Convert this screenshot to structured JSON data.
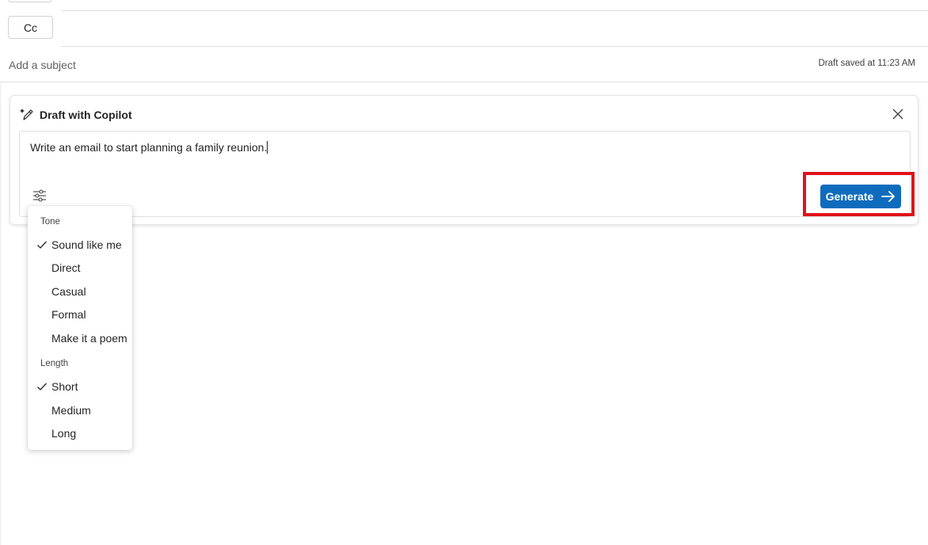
{
  "header": {
    "cc_label": "Cc",
    "subject_placeholder": "Add a subject",
    "draft_status": "Draft saved at 11:23 AM"
  },
  "copilot": {
    "title": "Draft with Copilot",
    "prompt_text": "Write an email to start planning a family reunion.",
    "generate_label": "Generate",
    "accent_color": "#0f6cbd",
    "highlight_color": "#e0131b",
    "icons": {
      "title_icon": "copilot-pen-sparkle-icon",
      "close_icon": "close-icon",
      "options_icon": "sliders-icon",
      "generate_icon": "arrow-right-icon"
    }
  },
  "menu": {
    "tone_header": "Tone",
    "tone_items": [
      {
        "label": "Sound like me",
        "selected": true
      },
      {
        "label": "Direct",
        "selected": false
      },
      {
        "label": "Casual",
        "selected": false
      },
      {
        "label": "Formal",
        "selected": false
      },
      {
        "label": "Make it a poem",
        "selected": false
      }
    ],
    "length_header": "Length",
    "length_items": [
      {
        "label": "Short",
        "selected": true
      },
      {
        "label": "Medium",
        "selected": false
      },
      {
        "label": "Long",
        "selected": false
      }
    ]
  }
}
